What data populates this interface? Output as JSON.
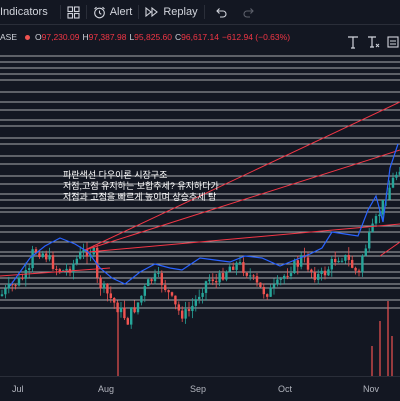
{
  "toolbar": {
    "indicators_label": "Indicators",
    "alert_label": "Alert",
    "replay_label": "Replay"
  },
  "legend": {
    "symbol_fragment": "ASE",
    "open_label": "O",
    "open_value": "97,230.09",
    "high_label": "H",
    "high_value": "97,387.98",
    "low_label": "L",
    "low_value": "95,825.60",
    "close_label": "C",
    "close_value": "96,617.14",
    "change": "−612.94 (−0.63%)"
  },
  "annotation": {
    "line1": "파란색선 다우이론 시장구조",
    "line2": "저점,고점 유지하는 보합추세? 유지하다가",
    "line3": "저점과 고점을 빠르게 높이며 상승추세 탐"
  },
  "xaxis": {
    "labels": [
      "Jul",
      "Aug",
      "Sep",
      "Oct",
      "Nov"
    ]
  },
  "colors": {
    "background": "#131722",
    "up": "#26a69a",
    "down": "#ef5350",
    "structure_line": "#2962ff",
    "trend_line": "#f23645",
    "level_line": "#ffffff"
  },
  "icons": [
    "indicators-icon",
    "layout-grid-icon",
    "alert-clock-icon",
    "replay-icon",
    "undo-icon",
    "redo-icon",
    "text-tool-icon",
    "text-tool-alt-icon",
    "note-tool-icon"
  ]
}
